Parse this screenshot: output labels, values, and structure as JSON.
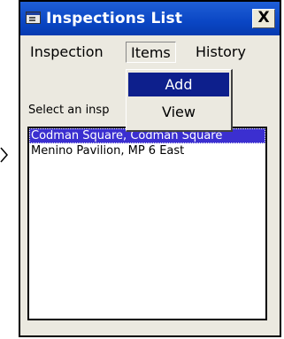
{
  "window": {
    "title": "Inspections List",
    "close_label": "X"
  },
  "menubar": {
    "items": [
      "Inspection",
      "Items",
      "History"
    ]
  },
  "items_menu": {
    "options": [
      "Add",
      "View"
    ],
    "highlighted": "Add"
  },
  "content": {
    "prompt": "Select an insp",
    "list": [
      "Codman Square, Codman Square",
      "Menino Pavilion, MP 6 East"
    ],
    "selected_index": 0
  },
  "colors": {
    "titlebar": "#0a46c4",
    "selection": "#3b2fd0",
    "menu_highlight": "#0d1f8c"
  },
  "icons": [
    "app-window-icon",
    "close-icon",
    "pointer-arrow-icon"
  ]
}
